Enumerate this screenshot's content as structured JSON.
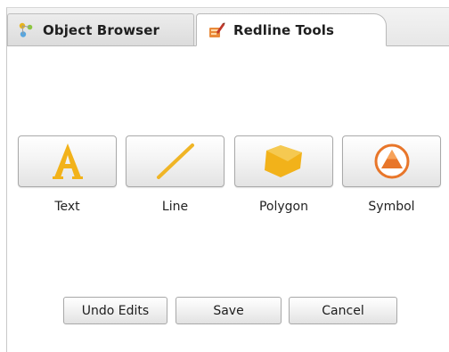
{
  "tabs": [
    {
      "label": "Object Browser",
      "icon": "object-browser-icon",
      "active": false
    },
    {
      "label": "Redline Tools",
      "icon": "redline-tools-icon",
      "active": true
    }
  ],
  "tools": [
    {
      "label": "Text",
      "icon": "text-a-icon"
    },
    {
      "label": "Line",
      "icon": "line-icon"
    },
    {
      "label": "Polygon",
      "icon": "polygon-icon"
    },
    {
      "label": "Symbol",
      "icon": "symbol-icon"
    }
  ],
  "actions": {
    "undo_label": "Undo Edits",
    "save_label": "Save",
    "cancel_label": "Cancel"
  },
  "colors": {
    "icon_gold": "#f2b21a",
    "icon_orange": "#e8762a",
    "icon_light_gold": "#f7d36a"
  }
}
